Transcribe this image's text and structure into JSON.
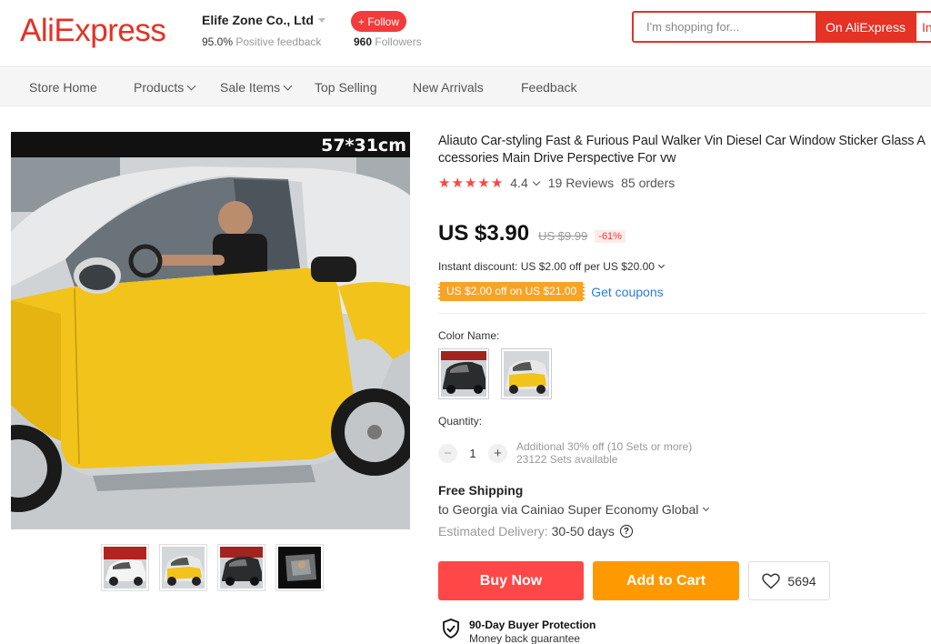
{
  "header": {
    "logo": "AliExpress",
    "store_name": "Elife Zone Co., Ltd",
    "feedback_percent": "95.0%",
    "feedback_label": "Positive feedback",
    "follow_label": "+ Follow",
    "followers_count": "960",
    "followers_label": "Followers",
    "search_placeholder": "I'm shopping for...",
    "search_on_aliexpress": "On AliExpress",
    "search_in_store": "In"
  },
  "store_nav": {
    "items": [
      {
        "label": "Store Home",
        "dropdown": false
      },
      {
        "label": "Products",
        "dropdown": true
      },
      {
        "label": "Sale Items",
        "dropdown": true
      },
      {
        "label": "Top Selling",
        "dropdown": false
      },
      {
        "label": "New Arrivals",
        "dropdown": false
      },
      {
        "label": "Feedback",
        "dropdown": false
      }
    ]
  },
  "gallery": {
    "size_label": "57*31cm",
    "thumbnail_icons": [
      "white-car-thumbnail",
      "yellow-car-thumbnail",
      "black-car-thumbnail",
      "sticker-closeup-thumbnail"
    ]
  },
  "product": {
    "title": "Aliauto Car-styling Fast & Furious Paul Walker Vin Diesel Car Window Sticker Glass Accessories Main Drive Perspective For vw",
    "rating": "4.4",
    "reviews": "19 Reviews",
    "orders": "85 orders",
    "price": "US $3.90",
    "original_price": "US $9.99",
    "discount": "-61%",
    "instant_discount": "Instant discount: US $2.00 off per US $20.00",
    "coupon": "US $2.00 off on US $21.00",
    "get_coupons": "Get coupons",
    "color_label": "Color Name:",
    "color_options": [
      "black-car",
      "yellow-car"
    ],
    "quantity_label": "Quantity:",
    "quantity_value": "1",
    "quantity_offer": "Additional 30% off (10 Sets or more)",
    "quantity_available": "23122 Sets available",
    "shipping_title": "Free Shipping",
    "shipping_to": "to Georgia via Cainiao Super Economy Global",
    "delivery_label": "Estimated Delivery:",
    "delivery_days": "30-50 days",
    "buy_now": "Buy Now",
    "add_to_cart": "Add to Cart",
    "wishlist_count": "5694",
    "protection_title": "90-Day Buyer Protection",
    "protection_sub": "Money back guarantee"
  },
  "colors": {
    "brand_red": "#e43225",
    "buy_now": "#ff4747",
    "add_to_cart": "#ff9900",
    "coupon": "#f7a325",
    "link_blue": "#2b7bd8",
    "star": "#ff4444"
  }
}
